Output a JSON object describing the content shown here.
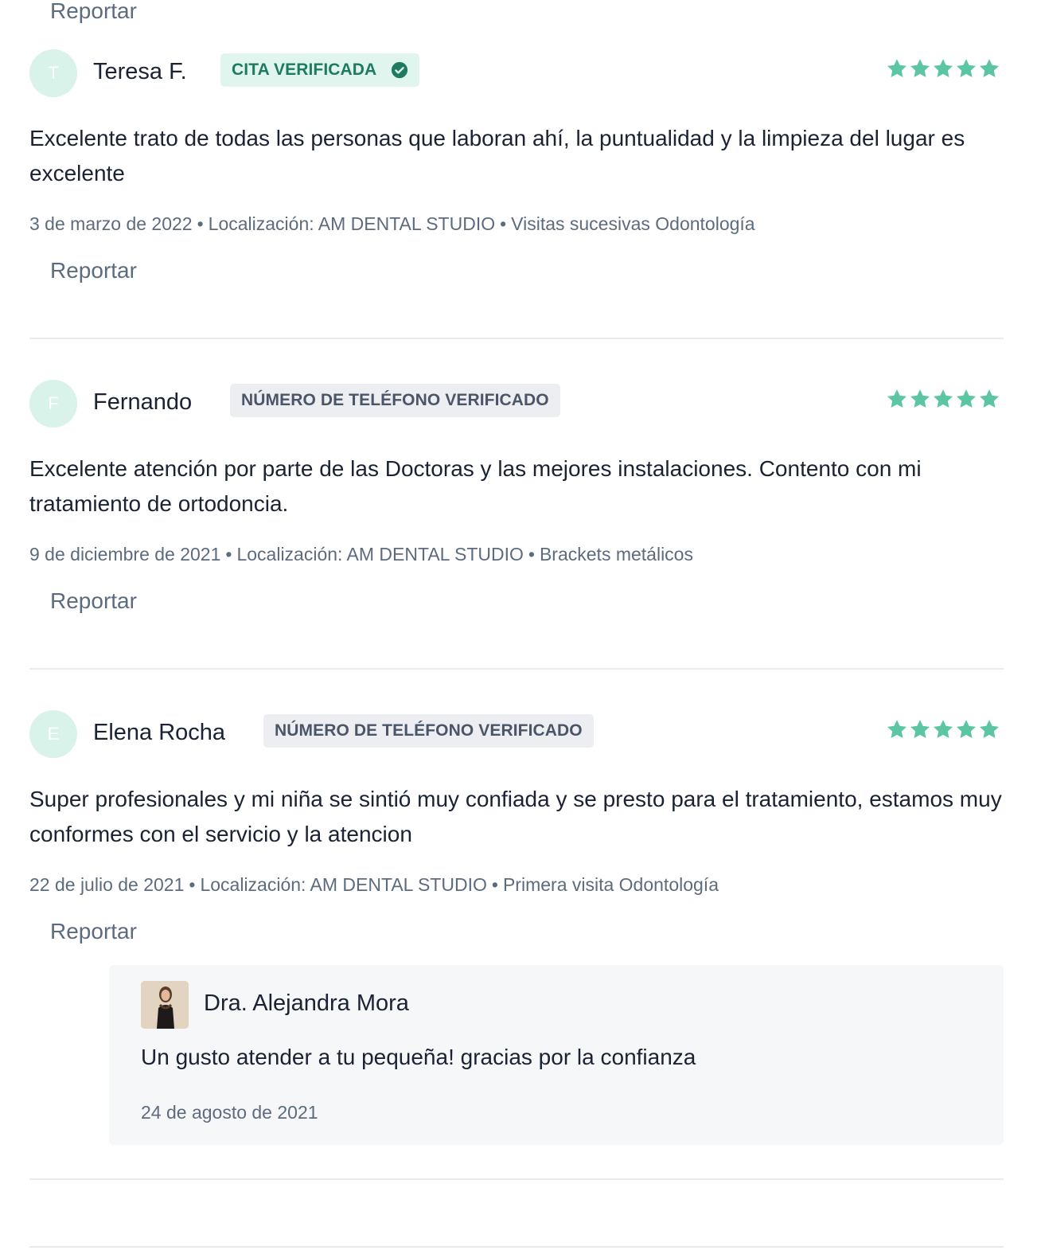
{
  "top_report_label": "Reportar",
  "reviews": [
    {
      "initial": "T",
      "author": "Teresa F.",
      "badge": "CITA VERIFICADA",
      "badge_type": "green",
      "badge_icon": "check-circle-icon",
      "rating": 5,
      "text": "Excelente trato de todas las personas que laboran ahí, la puntualidad y la limpieza del lugar es excelente",
      "date": "3 de marzo de 2022",
      "location": "Localización: AM DENTAL STUDIO",
      "service": "Visitas sucesivas Odontología",
      "report_label": "Reportar"
    },
    {
      "initial": "F",
      "author": "Fernando",
      "badge": "NÚMERO DE TELÉFONO VERIFICADO",
      "badge_type": "grey",
      "rating": 5,
      "text": "Excelente atención por parte de las Doctoras y las mejores instalaciones. Contento con mi tratamiento de ortodoncia.",
      "date": "9 de diciembre de 2021",
      "location": "Localización: AM DENTAL STUDIO",
      "service": "Brackets metálicos",
      "report_label": "Reportar"
    },
    {
      "initial": "E",
      "author": "Elena Rocha",
      "badge": "NÚMERO DE TELÉFONO VERIFICADO",
      "badge_type": "grey",
      "rating": 5,
      "text": "Super profesionales y mi niña se sintió muy confiada y se presto para el tratamiento, estamos muy conformes con el servicio y la atencion",
      "date": "22 de julio de 2021",
      "location": "Localización: AM DENTAL STUDIO",
      "service": "Primera visita Odontología",
      "report_label": "Reportar",
      "reply": {
        "doctor_name": "Dra. Alejandra Mora",
        "text": "Un gusto atender a tu pequeña! gracias por la confianza",
        "date": "24 de agosto de 2021"
      }
    }
  ],
  "colors": {
    "star": "#5cc6a4",
    "avatar_bg": "#d9f2ea",
    "badge_green_bg": "#e0f5ee",
    "badge_green_text": "#1f7a62",
    "badge_grey_bg": "#eceef2",
    "badge_grey_text": "#4a5568",
    "meta_text": "#5d6b7e",
    "reply_bg": "#f6f7f9"
  }
}
